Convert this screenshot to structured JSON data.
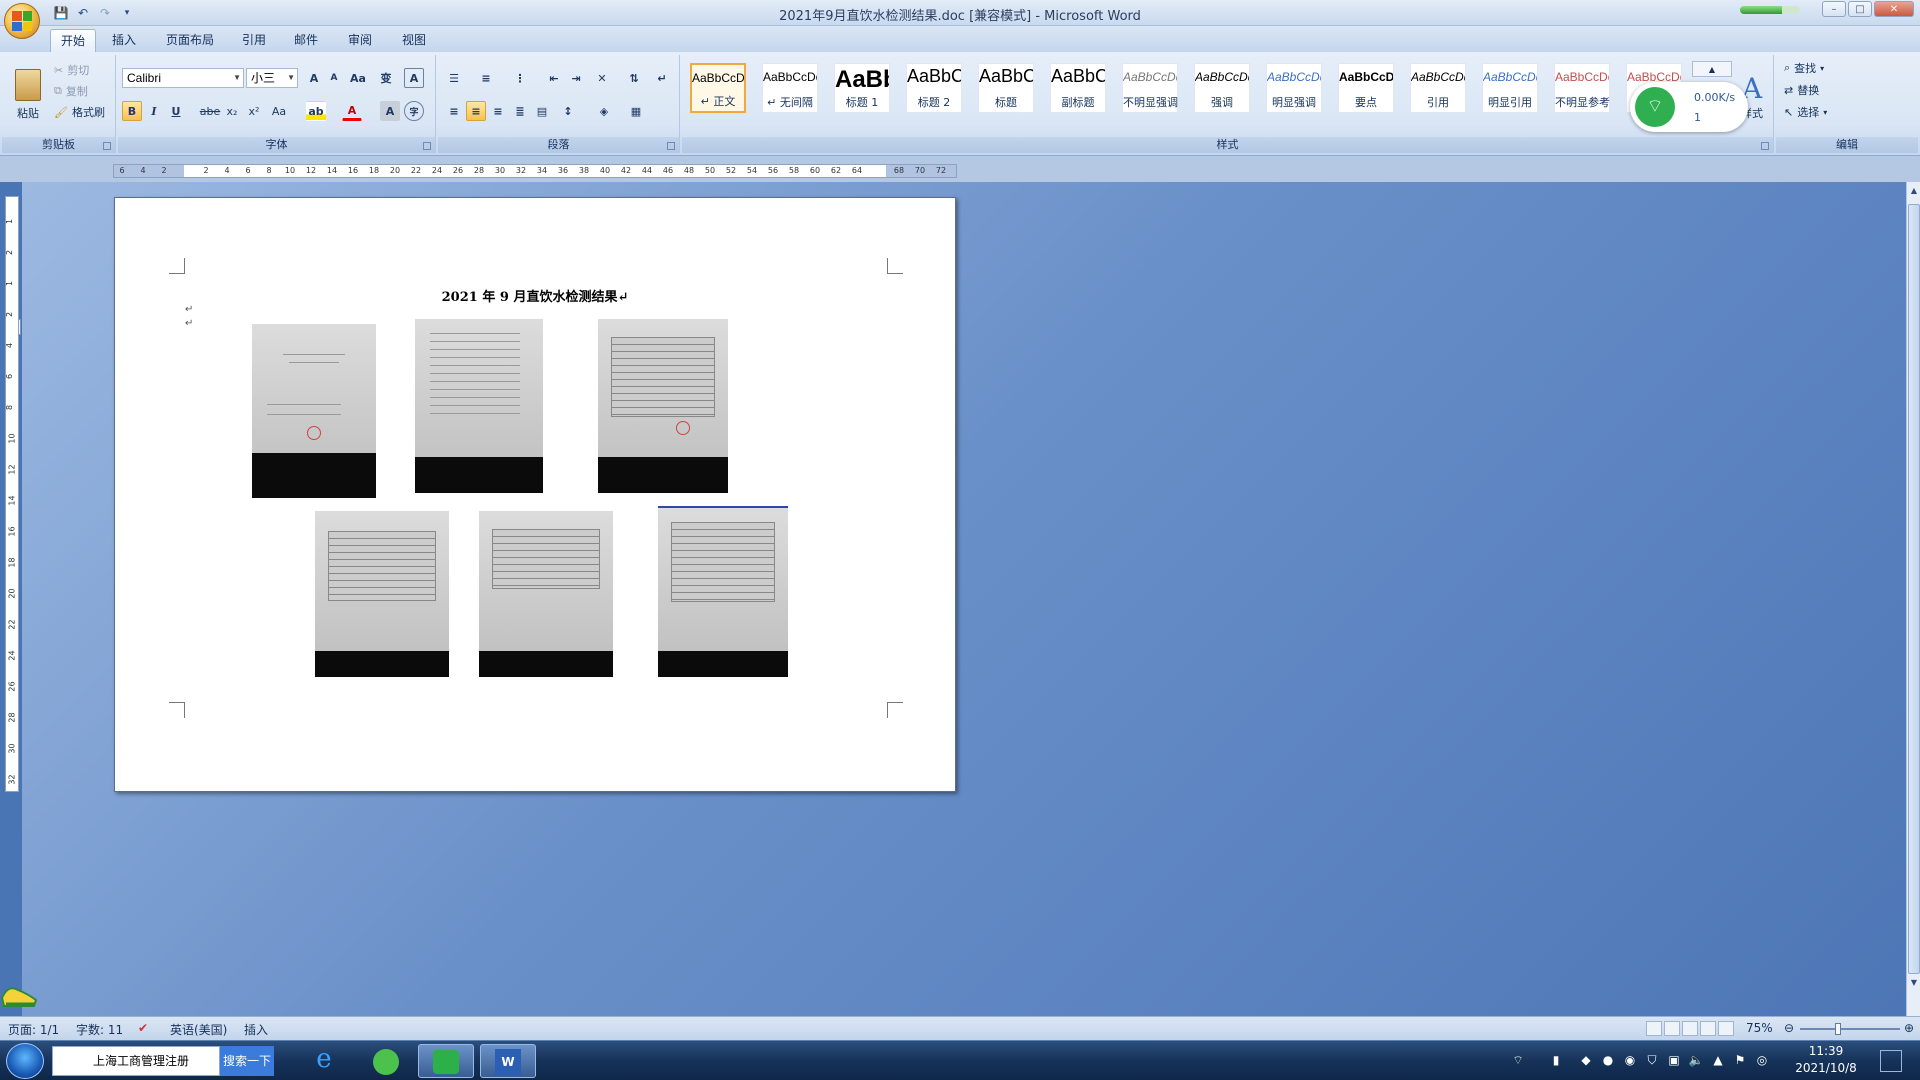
{
  "window": {
    "title": "2021年9月直饮水检测结果.doc [兼容模式] - Microsoft Word",
    "min": "–",
    "max": "□",
    "close": "✕",
    "network_progress_pct": 70
  },
  "quick_access": {
    "save": "💾",
    "undo": "↶",
    "redo": "↷",
    "more": "▾"
  },
  "tabs": [
    "开始",
    "插入",
    "页面布局",
    "引用",
    "邮件",
    "审阅",
    "视图"
  ],
  "ribbon": {
    "clipboard": {
      "label": "剪贴板",
      "paste": "粘贴",
      "cut": "剪切",
      "copy": "复制",
      "format_painter": "格式刷"
    },
    "font": {
      "label": "字体",
      "font_name": "Calibri",
      "font_size": "小三",
      "grow": "A",
      "shrink": "A",
      "clear": "Aa",
      "phonetic": "变",
      "border": "A",
      "bold": "B",
      "italic": "I",
      "underline": "U",
      "strike": "abe",
      "sub": "x₂",
      "sup": "x²",
      "case": "Aa",
      "highlight": "ab",
      "color": "A",
      "char_shade": "A",
      "enclose": "字"
    },
    "paragraph": {
      "label": "段落"
    },
    "styles": {
      "label": "样式",
      "change_styles": "样式",
      "items": [
        {
          "sample": "AaBbCcDd",
          "name": "↵ 正文"
        },
        {
          "sample": "AaBbCcDd",
          "name": "↵ 无间隔"
        },
        {
          "sample": "AaBb",
          "name": "标题 1"
        },
        {
          "sample": "AaBbC",
          "name": "标题 2"
        },
        {
          "sample": "AaBbC",
          "name": "标题"
        },
        {
          "sample": "AaBbC",
          "name": "副标题"
        },
        {
          "sample": "AaBbCcDd",
          "name": "不明显强调"
        },
        {
          "sample": "AaBbCcDd",
          "name": "强调"
        },
        {
          "sample": "AaBbCcDd",
          "name": "明显强调"
        },
        {
          "sample": "AaBbCcDd",
          "name": "要点"
        },
        {
          "sample": "AaBbCcDd",
          "name": "引用"
        },
        {
          "sample": "AaBbCcDd",
          "name": "明显引用"
        },
        {
          "sample": "AaBbCcDd",
          "name": "不明显参考"
        },
        {
          "sample": "AaBbCcDd",
          "name": ""
        }
      ]
    },
    "editing": {
      "label": "编辑",
      "find": "查找",
      "replace": "替换",
      "select": "选择"
    }
  },
  "net_widget": {
    "speed": "0.00K/s",
    "count": "1"
  },
  "ruler_ticks": [
    "6",
    "4",
    "2",
    "",
    "2",
    "4",
    "6",
    "8",
    "10",
    "12",
    "14",
    "16",
    "18",
    "20",
    "22",
    "24",
    "26",
    "28",
    "30",
    "32",
    "34",
    "36",
    "38",
    "40",
    "42",
    "44",
    "46",
    "48",
    "50",
    "52",
    "54",
    "56",
    "58",
    "60",
    "62",
    "64",
    "",
    "68",
    "70",
    "72"
  ],
  "vruler_ticks": [
    "1",
    "2",
    "1",
    "2",
    "4",
    "6",
    "8",
    "10",
    "12",
    "14",
    "16",
    "18",
    "20",
    "22",
    "24",
    "26",
    "28",
    "30",
    "32"
  ],
  "document": {
    "heading": "2021 年 9 月直饮水检测结果↵",
    "para_marks": [
      "↵",
      "↵"
    ]
  },
  "statusbar": {
    "page": "页面: 1/1",
    "words": "字数: 11",
    "language": "英语(美国)",
    "mode": "插入",
    "zoom": "75%",
    "zoom_level_pct": 75
  },
  "taskbar": {
    "search_text": "上海工商管理注册",
    "search_button": "搜索一下",
    "time": "11:39",
    "date": "2021/10/8"
  },
  "colors": {
    "accent": "#f2a93b",
    "ribbon": "#dae6f5",
    "workspace": "#6a90c9",
    "wifi": "#2faf4f"
  }
}
